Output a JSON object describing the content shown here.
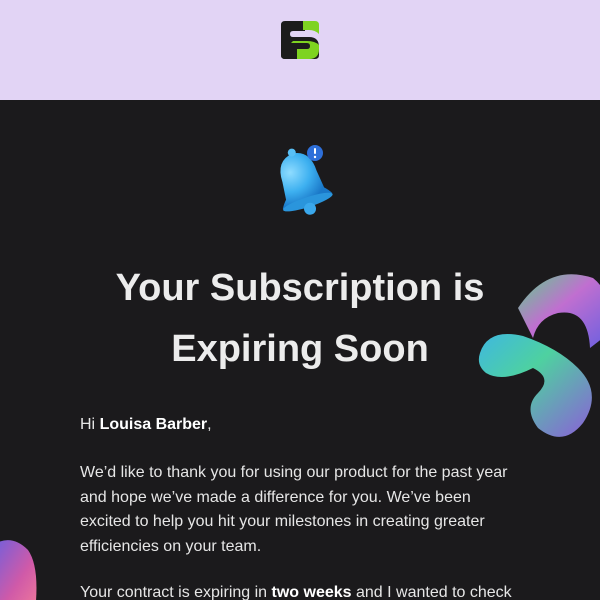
{
  "header": {
    "logo_icon": "brand-logo-icon",
    "background_color": "#e2d4f5"
  },
  "hero": {
    "bell_icon": "notification-bell-icon",
    "title": "Your Subscription is Expiring Soon"
  },
  "message": {
    "greeting_prefix": "Hi ",
    "recipient_name": "Louisa Barber",
    "greeting_suffix": ",",
    "para1": "We’d like to thank you for using our product for the past year and hope we’ve made a difference for you. We’ve been excited to help you hit your milestones in creating greater efficiencies on your team.",
    "para2_prefix": "Your contract is expiring in ",
    "para2_emphasis": "two weeks",
    "para2_suffix": " and I wanted to check"
  },
  "colors": {
    "body_background": "#1b1a1c",
    "logo_green": "#7ed321",
    "bell_blue": "#3db0f0"
  }
}
